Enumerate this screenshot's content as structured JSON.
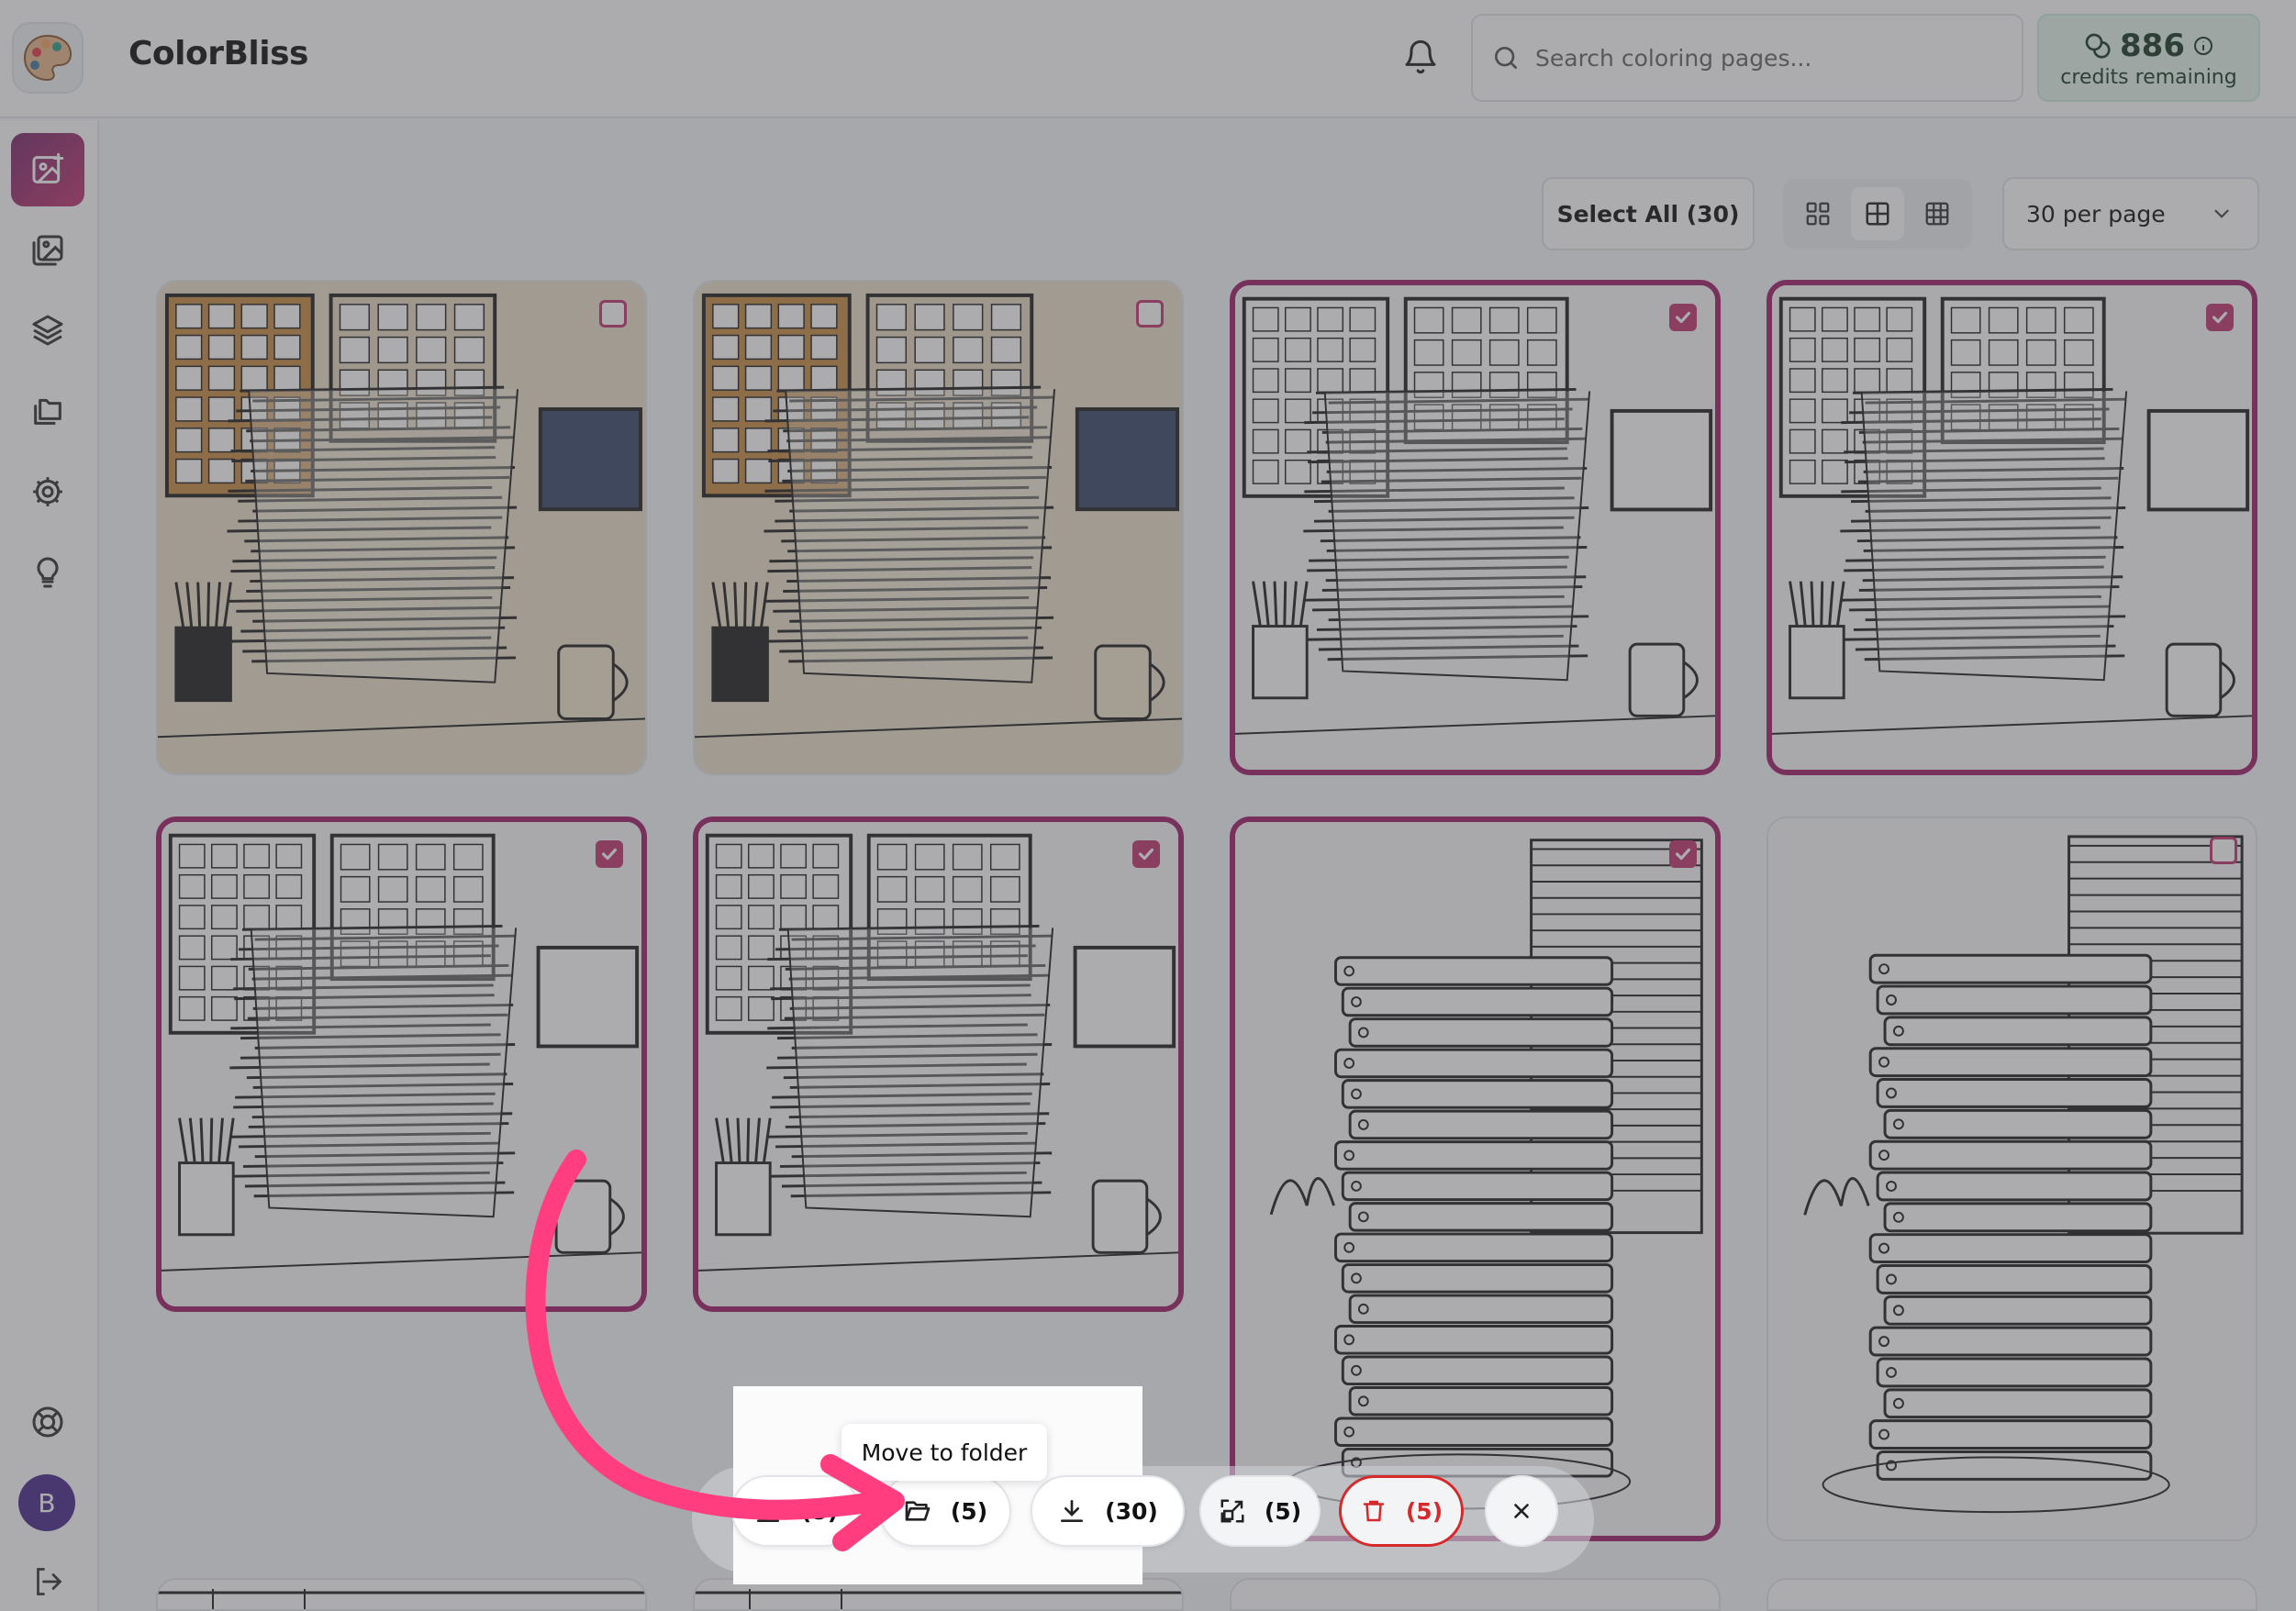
{
  "app": {
    "title": "ColorBliss"
  },
  "header": {
    "search_placeholder": "Search coloring pages...",
    "credits_number": "886",
    "credits_label": "credits remaining"
  },
  "sidebar": {
    "items": [
      {
        "icon": "image-plus-icon",
        "active": true
      },
      {
        "icon": "gallery-icon"
      },
      {
        "icon": "layers-icon"
      },
      {
        "icon": "folders-icon"
      },
      {
        "icon": "gear-icon"
      },
      {
        "icon": "lightbulb-icon"
      }
    ],
    "bottom": [
      {
        "icon": "help-lifebuoy-icon"
      },
      {
        "icon": "logout-icon"
      }
    ],
    "avatar_letter": "B"
  },
  "toolbar": {
    "select_all_label": "Select All (30)",
    "per_page_label": "30 per page"
  },
  "bulk_actions": {
    "download_selected_count": "(5)",
    "move_count": "(5)",
    "download_all_count": "(30)",
    "upscale_count": "(5)",
    "delete_count": "(5)",
    "tooltip": "Move to folder"
  },
  "grid": {
    "items": [
      {
        "selected": false,
        "style": "sepia"
      },
      {
        "selected": false,
        "style": "sepia"
      },
      {
        "selected": true,
        "style": "line"
      },
      {
        "selected": true,
        "style": "line"
      },
      {
        "selected": true,
        "style": "line"
      },
      {
        "selected": true,
        "style": "line"
      },
      {
        "selected": true,
        "style": "binders"
      },
      {
        "selected": false,
        "style": "binders"
      }
    ]
  },
  "colors": {
    "accent": "#c2376f",
    "selected_border": "#a01e6a",
    "danger": "#d62a2a",
    "credits_bg": "#e3f5ea",
    "arrow": "#ff3d7f"
  }
}
